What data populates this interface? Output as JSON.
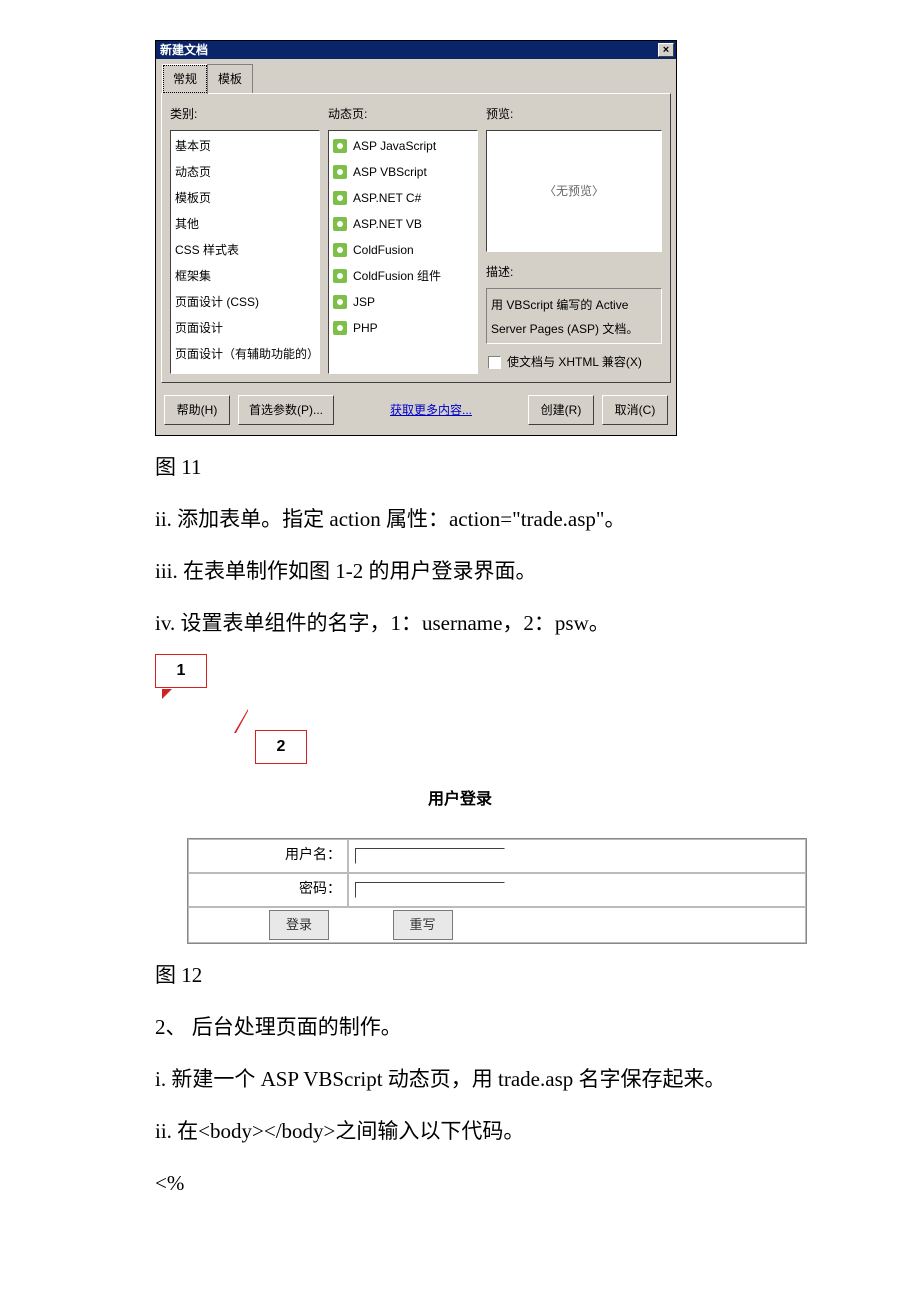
{
  "dialog": {
    "title": "新建文档",
    "close_glyph": "×",
    "tabs": {
      "general": "常规",
      "template": "模板"
    },
    "labels": {
      "category": "类别:",
      "dynamic": "动态页:",
      "preview": "预览:",
      "desc": "描述:"
    },
    "categories": [
      "基本页",
      "动态页",
      "模板页",
      "其他",
      "CSS 样式表",
      "框架集",
      "页面设计 (CSS)",
      "页面设计",
      "页面设计（有辅助功能的）"
    ],
    "dynamic_items": [
      "ASP JavaScript",
      "ASP VBScript",
      "ASP.NET C#",
      "ASP.NET VB",
      "ColdFusion",
      "ColdFusion 组件",
      "JSP",
      "PHP"
    ],
    "preview_placeholder": "〈无预览〉",
    "desc_text": "用 VBScript 编写的 Active Server Pages (ASP) 文档。",
    "checkbox_label": "使文档与 XHTML 兼容(X)",
    "buttons": {
      "help": "帮助(H)",
      "prefs": "首选参数(P)...",
      "more": "获取更多内容...",
      "create": "创建(R)",
      "cancel": "取消(C)"
    }
  },
  "text": {
    "fig11": "图 11",
    "p_ii": "ii. 添加表单。指定 action 属性：action=\"trade.asp\"。",
    "p_iii": "iii. 在表单制作如图 1-2 的用户登录界面。",
    "p_iv": "iv. 设置表单组件的名字，1：username，2：psw。",
    "fig12": "图 12",
    "p_2": "2、 后台处理页面的制作。",
    "p_i2": "i. 新建一个 ASP VBScript 动态页，用 trade.asp 名字保存起来。",
    "p_ii2": "ii. 在<body></body>之间输入以下代码。",
    "p_code": "<%"
  },
  "callouts": {
    "one": "1",
    "two": "2"
  },
  "login": {
    "title": "用户登录",
    "username_label": "用户名：",
    "password_label": "密码：",
    "submit": "登录",
    "reset": "重写"
  }
}
